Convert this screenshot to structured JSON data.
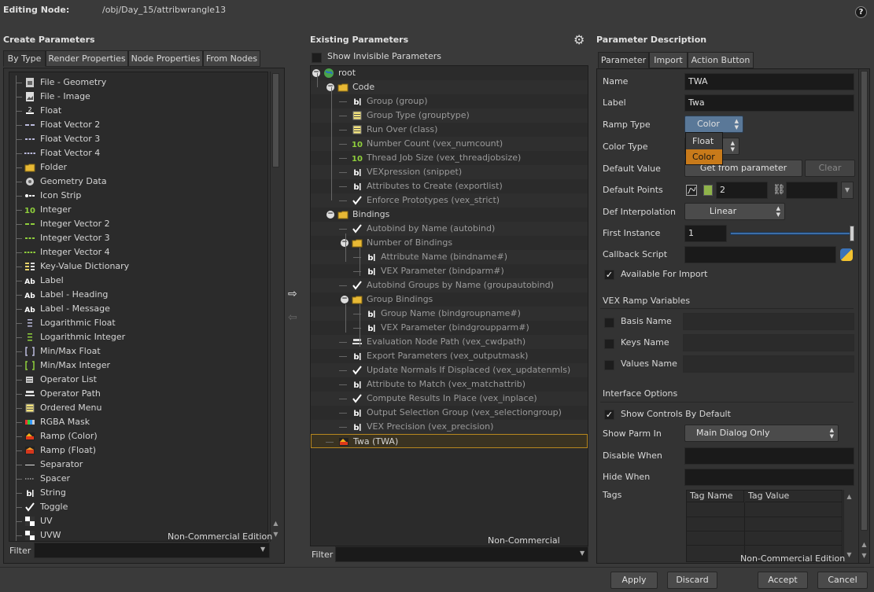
{
  "header": {
    "label": "Editing Node:",
    "path": "/obj/Day_15/attribwrangle13"
  },
  "create": {
    "title": "Create Parameters",
    "tabs": [
      "By Type",
      "Render Properties",
      "Node Properties",
      "From Nodes"
    ],
    "items": [
      {
        "label": "File - Geometry",
        "icon": "file-geometry-icon"
      },
      {
        "label": "File - Image",
        "icon": "file-image-icon"
      },
      {
        "label": "Float",
        "icon": "float-icon"
      },
      {
        "label": "Float Vector 2",
        "icon": "float-vector-2-icon"
      },
      {
        "label": "Float Vector 3",
        "icon": "float-vector-3-icon"
      },
      {
        "label": "Float Vector 4",
        "icon": "float-vector-4-icon"
      },
      {
        "label": "Folder",
        "icon": "folder-icon"
      },
      {
        "label": "Geometry Data",
        "icon": "geometry-data-icon"
      },
      {
        "label": "Icon Strip",
        "icon": "icon-strip-icon"
      },
      {
        "label": "Integer",
        "icon": "integer-icon"
      },
      {
        "label": "Integer Vector 2",
        "icon": "integer-vector-2-icon"
      },
      {
        "label": "Integer Vector 3",
        "icon": "integer-vector-3-icon"
      },
      {
        "label": "Integer Vector 4",
        "icon": "integer-vector-4-icon"
      },
      {
        "label": "Key-Value Dictionary",
        "icon": "key-value-icon"
      },
      {
        "label": "Label",
        "icon": "label-icon"
      },
      {
        "label": "Label - Heading",
        "icon": "label-heading-icon"
      },
      {
        "label": "Label - Message",
        "icon": "label-message-icon"
      },
      {
        "label": "Logarithmic Float",
        "icon": "log-float-icon"
      },
      {
        "label": "Logarithmic Integer",
        "icon": "log-integer-icon"
      },
      {
        "label": "Min/Max Float",
        "icon": "minmax-float-icon"
      },
      {
        "label": "Min/Max Integer",
        "icon": "minmax-integer-icon"
      },
      {
        "label": "Operator List",
        "icon": "operator-list-icon"
      },
      {
        "label": "Operator Path",
        "icon": "operator-path-icon"
      },
      {
        "label": "Ordered Menu",
        "icon": "ordered-menu-icon"
      },
      {
        "label": "RGBA Mask",
        "icon": "rgba-mask-icon"
      },
      {
        "label": "Ramp (Color)",
        "icon": "ramp-color-icon"
      },
      {
        "label": "Ramp (Float)",
        "icon": "ramp-float-icon"
      },
      {
        "label": "Separator",
        "icon": "separator-icon"
      },
      {
        "label": "Spacer",
        "icon": "spacer-icon"
      },
      {
        "label": "String",
        "icon": "string-icon"
      },
      {
        "label": "Toggle",
        "icon": "toggle-icon"
      },
      {
        "label": "UV",
        "icon": "uv-icon"
      },
      {
        "label": "UVW",
        "icon": "uvw-icon"
      }
    ],
    "watermark": "Non-Commercial Edition",
    "filter_label": "Filter",
    "filter_value": ""
  },
  "existing": {
    "title": "Existing Parameters",
    "show_invisible": "Show Invisible Parameters",
    "tree": [
      {
        "label": "root",
        "icon": "globe-icon",
        "level": 0,
        "expand": true,
        "dim": false
      },
      {
        "label": "Code",
        "icon": "folder-icon",
        "level": 1,
        "expand": true,
        "dim": false
      },
      {
        "label": "Group (group)",
        "icon": "string-icon",
        "level": 2,
        "dim": true
      },
      {
        "label": "Group Type (grouptype)",
        "icon": "ordered-menu-icon",
        "level": 2,
        "dim": true
      },
      {
        "label": "Run Over (class)",
        "icon": "ordered-menu-icon",
        "level": 2,
        "dim": true
      },
      {
        "label": "Number Count (vex_numcount)",
        "icon": "integer-icon",
        "level": 2,
        "dim": true
      },
      {
        "label": "Thread Job Size (vex_threadjobsize)",
        "icon": "integer-icon",
        "level": 2,
        "dim": true
      },
      {
        "label": "VEXpression (snippet)",
        "icon": "string-icon",
        "level": 2,
        "dim": true
      },
      {
        "label": "Attributes to Create (exportlist)",
        "icon": "string-icon",
        "level": 2,
        "dim": true
      },
      {
        "label": "Enforce Prototypes (vex_strict)",
        "icon": "toggle-icon",
        "level": 2,
        "dim": true
      },
      {
        "label": "Bindings",
        "icon": "folder-icon",
        "level": 1,
        "expand": true,
        "dim": false
      },
      {
        "label": "Autobind by Name (autobind)",
        "icon": "toggle-icon",
        "level": 2,
        "dim": true
      },
      {
        "label": "Number of Bindings",
        "icon": "folder-icon",
        "level": 2,
        "expand": true,
        "dim": true
      },
      {
        "label": "Attribute Name (bindname#)",
        "icon": "string-icon",
        "level": 3,
        "dim": true
      },
      {
        "label": "VEX Parameter (bindparm#)",
        "icon": "string-icon",
        "level": 3,
        "dim": true
      },
      {
        "label": "Autobind Groups by Name (groupautobind)",
        "icon": "toggle-icon",
        "level": 2,
        "dim": true
      },
      {
        "label": "Group Bindings",
        "icon": "folder-icon",
        "level": 2,
        "expand": true,
        "dim": true
      },
      {
        "label": "Group Name (bindgroupname#)",
        "icon": "string-icon",
        "level": 3,
        "dim": true
      },
      {
        "label": "VEX Parameter (bindgroupparm#)",
        "icon": "string-icon",
        "level": 3,
        "dim": true
      },
      {
        "label": "Evaluation Node Path (vex_cwdpath)",
        "icon": "operator-path-icon",
        "level": 2,
        "dim": true
      },
      {
        "label": "Export Parameters (vex_outputmask)",
        "icon": "string-icon",
        "level": 2,
        "dim": true
      },
      {
        "label": "Update Normals If Displaced (vex_updatenmls)",
        "icon": "toggle-icon",
        "level": 2,
        "dim": true
      },
      {
        "label": "Attribute to Match (vex_matchattrib)",
        "icon": "string-icon",
        "level": 2,
        "dim": true
      },
      {
        "label": "Compute Results In Place (vex_inplace)",
        "icon": "toggle-icon",
        "level": 2,
        "dim": true
      },
      {
        "label": "Output Selection Group (vex_selectiongroup)",
        "icon": "string-icon",
        "level": 2,
        "dim": true
      },
      {
        "label": "VEX Precision (vex_precision)",
        "icon": "string-icon",
        "level": 2,
        "dim": true
      },
      {
        "label": "Twa (TWA)",
        "icon": "ramp-color-icon",
        "level": 1,
        "dim": false,
        "selected": true
      }
    ],
    "watermark": "Non-Commercial Edition",
    "filter_label": "Filter",
    "filter_value": ""
  },
  "desc": {
    "title": "Parameter Description",
    "tabs": [
      "Parameter",
      "Import",
      "Action Button"
    ],
    "name_label": "Name",
    "name_value": "TWA",
    "label_label": "Label",
    "label_value": "Twa",
    "ramp_type_label": "Ramp Type",
    "ramp_type_value": "Color",
    "ramp_options": [
      "Float",
      "Color"
    ],
    "color_type_label": "Color Type",
    "default_value_label": "Default Value",
    "get_from_param": "Get from parameter",
    "clear": "Clear",
    "default_points_label": "Default Points",
    "default_points_value": "2",
    "def_interp_label": "Def Interpolation",
    "def_interp_value": "Linear",
    "first_instance_label": "First Instance",
    "first_instance_value": "1",
    "callback_label": "Callback Script",
    "callback_value": "",
    "available_import": "Available For Import",
    "vex_ramp_title": "VEX Ramp Variables",
    "basis_name": "Basis Name",
    "keys_name": "Keys Name",
    "values_name": "Values Name",
    "interface_title": "Interface Options",
    "show_controls": "Show Controls By Default",
    "show_parm_in_label": "Show Parm In",
    "show_parm_in_value": "Main Dialog Only",
    "disable_when": "Disable When",
    "hide_when": "Hide When",
    "tags_label": "Tags",
    "tag_name_header": "Tag Name",
    "tag_value_header": "Tag Value",
    "watermark": "Non-Commercial Edition"
  },
  "footer": {
    "apply": "Apply",
    "discard": "Discard",
    "accept": "Accept",
    "cancel": "Cancel"
  },
  "colors": {
    "accent_orange": "#c87a1a",
    "selection_border": "#b7871f",
    "folder": "#e8b935"
  }
}
